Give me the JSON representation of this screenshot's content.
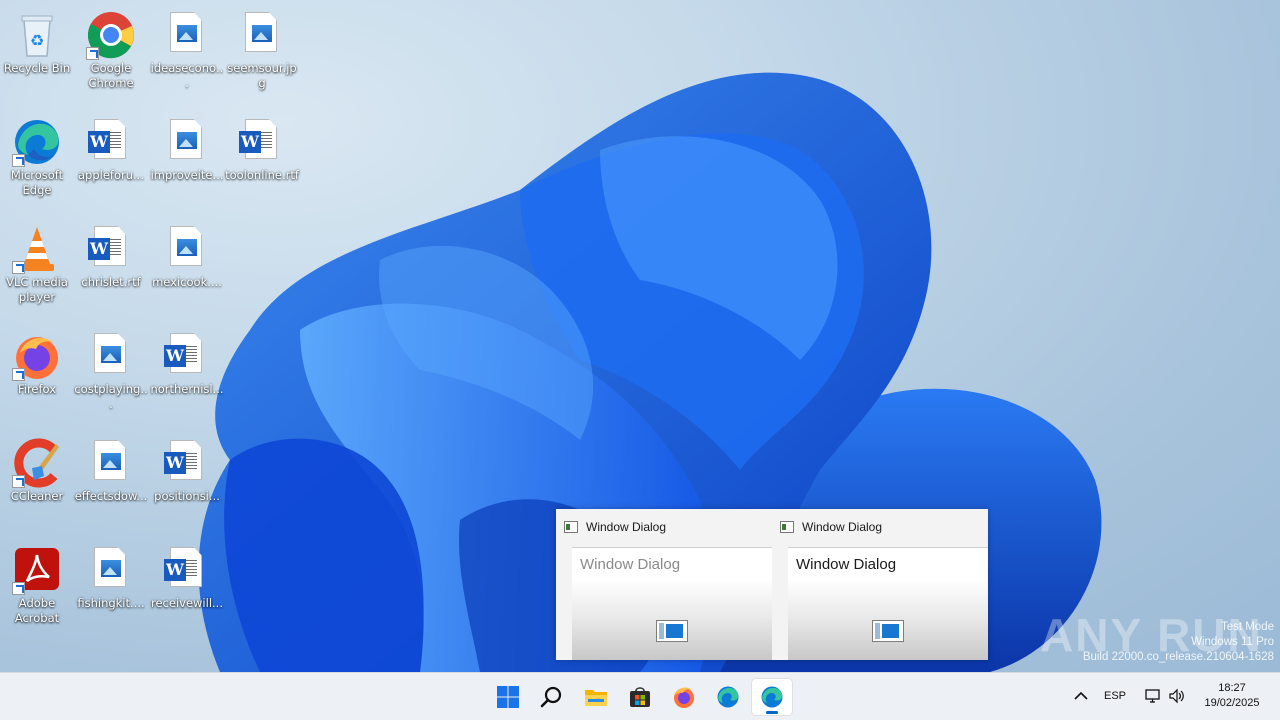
{
  "desktop": {
    "icons": [
      {
        "label": "Recycle Bin",
        "icon": "recycle-bin-icon"
      },
      {
        "label": "Google Chrome",
        "icon": "chrome-icon"
      },
      {
        "label": "ideaseconо...",
        "icon": "image-file-icon"
      },
      {
        "label": "seemsour.jpg",
        "icon": "image-file-icon"
      },
      {
        "label": "Microsoft Edge",
        "icon": "edge-icon"
      },
      {
        "label": "appleforu...",
        "icon": "word-file-icon"
      },
      {
        "label": "improveite...",
        "icon": "image-file-icon"
      },
      {
        "label": "toolonline.rtf",
        "icon": "word-file-icon"
      },
      {
        "label": "VLC media player",
        "icon": "vlc-icon"
      },
      {
        "label": "chrislet.rtf",
        "icon": "word-file-icon"
      },
      {
        "label": "mexicook....",
        "icon": "image-file-icon"
      },
      {
        "label": "Firefox",
        "icon": "firefox-icon"
      },
      {
        "label": "costplaying...",
        "icon": "image-file-icon"
      },
      {
        "label": "northernisl...",
        "icon": "word-file-icon"
      },
      {
        "label": "CCleaner",
        "icon": "ccleaner-icon"
      },
      {
        "label": "effectsdow...",
        "icon": "image-file-icon"
      },
      {
        "label": "positionsi...",
        "icon": "word-file-icon"
      },
      {
        "label": "Adobe Acrobat",
        "icon": "acrobat-icon"
      },
      {
        "label": "fishingkit....",
        "icon": "image-file-icon"
      },
      {
        "label": "receivewill...",
        "icon": "word-file-icon"
      }
    ]
  },
  "dialogs": [
    {
      "title": "Window Dialog",
      "content": "Window Dialog",
      "content_color": "#8a8a8a"
    },
    {
      "title": "Window Dialog",
      "content": "Window Dialog",
      "content_color": "#1a1a1a"
    }
  ],
  "watermark": {
    "brand": "ANY RUN",
    "line1": "Test Mode",
    "line2": "Windows 11 Pro",
    "line3": "Build 22000.co_release.210604-1628"
  },
  "taskbar": {
    "apps": [
      "start-icon",
      "search-icon",
      "file-explorer-icon",
      "store-icon",
      "firefox-icon",
      "edge-icon",
      "edge-icon"
    ],
    "language": "ESP",
    "time": "18:27",
    "date": "19/02/2025"
  },
  "colors": {
    "accent": "#0067c0",
    "taskbar_bg": "#edf1f5",
    "wallpaper_blue": "#1459e0"
  }
}
